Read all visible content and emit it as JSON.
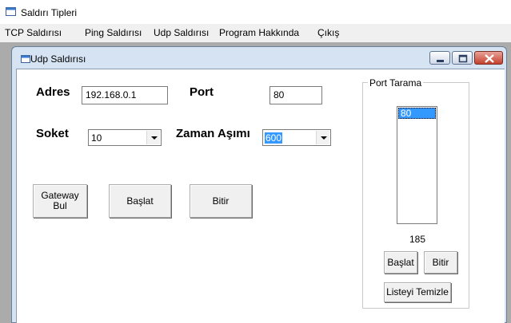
{
  "app": {
    "title": "Saldırı Tipleri"
  },
  "menu": {
    "tcp": "TCP Saldırısı",
    "ping": "Ping Saldırısı",
    "udp": "Udp Saldırısı",
    "about": "Program Hakkında",
    "exit": "Çıkış"
  },
  "child": {
    "title": "Udp Saldırısı"
  },
  "form": {
    "address_label": "Adres",
    "address_value": "192.168.0.1",
    "port_label": "Port",
    "port_value": "80",
    "socket_label": "Soket",
    "socket_value": "10",
    "timeout_label": "Zaman Aşımı",
    "timeout_value": "600",
    "gateway_line1": "Gateway",
    "gateway_line2": "Bul",
    "start_label": "Başlat",
    "stop_label": "Bitir"
  },
  "port_scan": {
    "group_label": "Port Tarama",
    "items": [
      "80"
    ],
    "count": "185",
    "start_label": "Başlat",
    "stop_label": "Bitir",
    "clear_label": "Listeyi Temizle"
  },
  "icons": {
    "app": "window-app-icon",
    "child": "child-window-icon",
    "minimize": "minimize-icon",
    "maximize": "maximize-icon",
    "close": "close-icon"
  }
}
